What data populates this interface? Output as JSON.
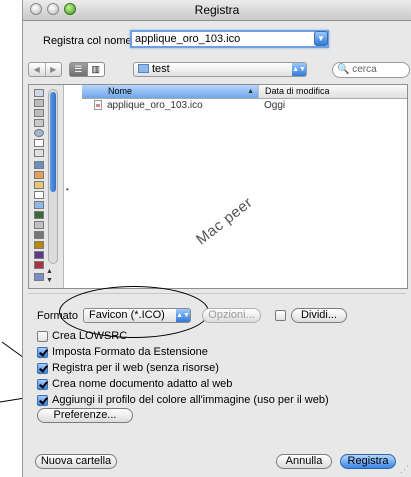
{
  "window": {
    "title": "Registra"
  },
  "save": {
    "label": "Registra col nome:",
    "filename": "applique_oro_103.ico"
  },
  "toolbar": {
    "folder": "test",
    "search_placeholder": "cerca"
  },
  "file_browser": {
    "columns": {
      "name": "Nome",
      "date": "Data di modifica"
    },
    "rows": [
      {
        "name": "applique_oro_103.ico",
        "date": "Oggi"
      }
    ]
  },
  "watermark": "Mac peer",
  "format": {
    "label": "Formato",
    "selected": "Favicon (*.ICO)",
    "options_button": "Opzioni...",
    "split_label": "Dividi..."
  },
  "options": [
    {
      "label": "Crea LOWSRC",
      "checked": false
    },
    {
      "label": "Imposta Formato da Estensione",
      "checked": true
    },
    {
      "label": "Registra per il web (senza risorse)",
      "checked": true
    },
    {
      "label": "Crea nome documento adatto al web",
      "checked": true
    },
    {
      "label": "Aggiungi il profilo del colore all'immagine (uso per il web)",
      "checked": true
    }
  ],
  "buttons": {
    "preferences": "Preferenze...",
    "new_folder": "Nuova cartella",
    "cancel": "Annulla",
    "save": "Registra"
  },
  "colors": {
    "accent": "#3a86e6",
    "titlebar": "#c9c9c9",
    "window_bg": "#e8e8e8"
  }
}
